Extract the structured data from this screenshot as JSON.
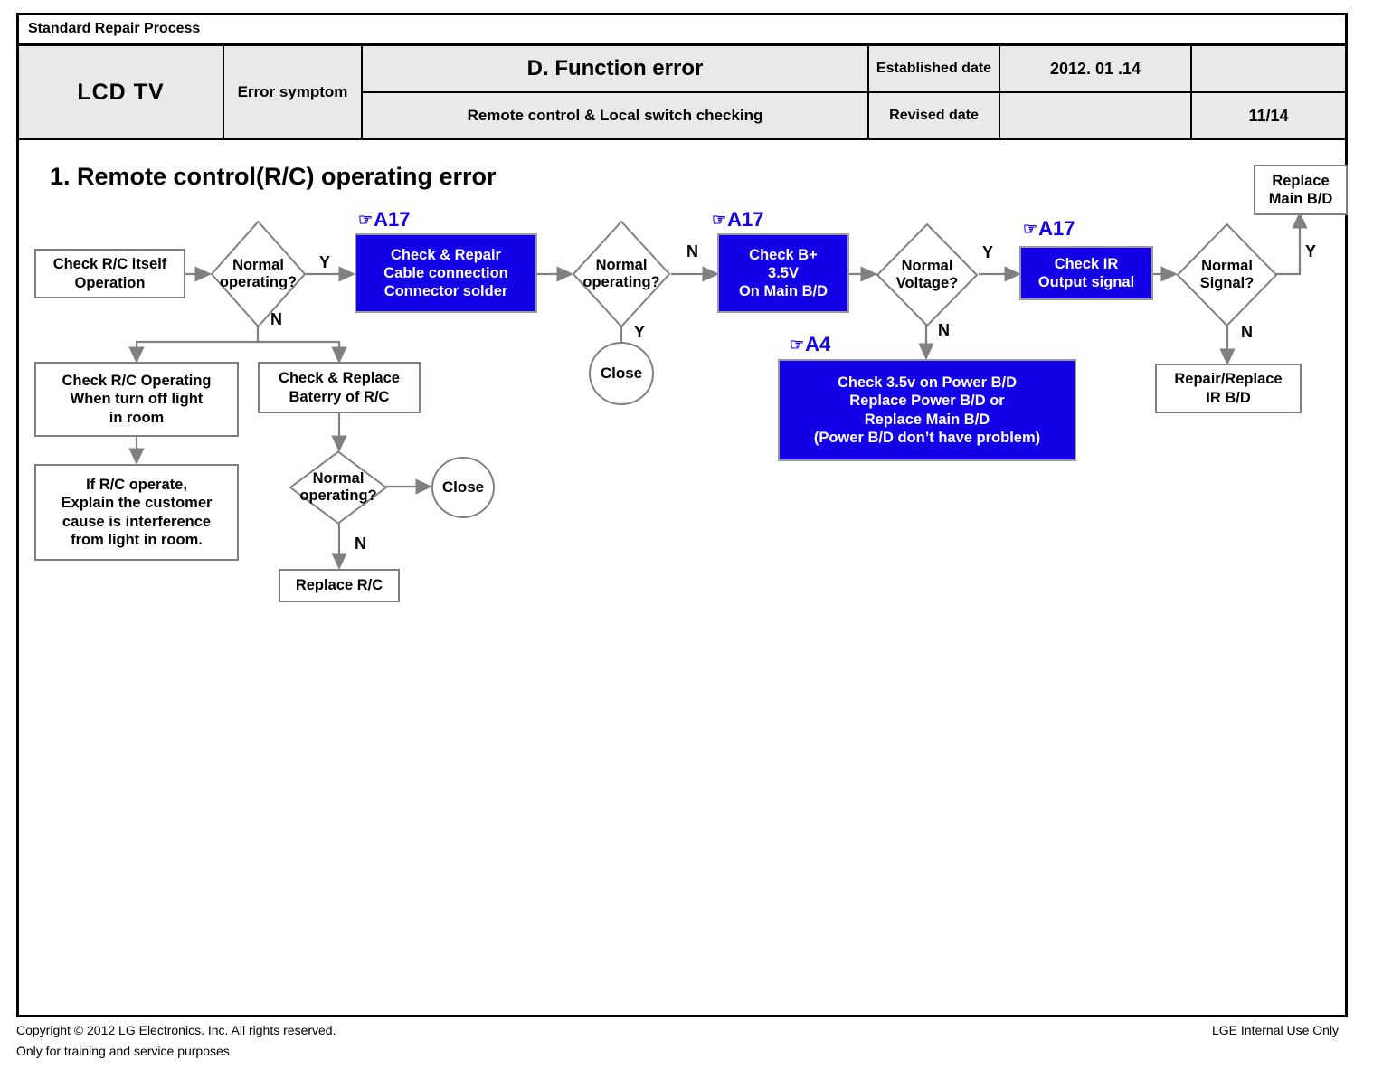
{
  "header": {
    "standard_title": "Standard Repair Process",
    "product": "LCD  TV",
    "error_symptom_label": "Error symptom",
    "function_error": "D. Function error",
    "subject": "Remote control & Local switch checking",
    "established_date_label": "Established date",
    "established_date_value": "2012. 01 .14",
    "revised_date_label": "Revised date",
    "revised_date_value": "",
    "blank_cell": "",
    "page_number": "11/14"
  },
  "section": {
    "title": "1. Remote control(R/C) operating error"
  },
  "flow": {
    "nodes": {
      "check_rc_itself": "Check R/C itself\nOperation",
      "d1": "Normal\noperating?",
      "check_repair_cable": "Check & Repair\nCable connection\nConnector solder",
      "d2": "Normal\noperating?",
      "close1": "Close",
      "check_b_plus": "Check B+\n3.5V\nOn Main B/D",
      "d3": "Normal\nVoltage?",
      "check_3_5v_power": "Check 3.5v on Power B/D\nReplace Power B/D or\nReplace Main B/D\n(Power B/D don’t have problem)",
      "check_ir": "Check IR\nOutput signal",
      "d4": "Normal\nSignal?",
      "replace_main_bd": "Replace\nMain B/D",
      "repair_replace_ir": "Repair/Replace\nIR B/D",
      "check_rc_operating_light": "Check R/C Operating\nWhen turn off light\nin room",
      "explain_customer": "If R/C operate,\nExplain the customer\ncause is interference\nfrom light in room.",
      "check_replace_battery": "Check & Replace\nBaterry of R/C",
      "d5": "Normal\noperating?",
      "close2": "Close",
      "replace_rc": "Replace R/C"
    },
    "tags": {
      "a17_1": "A17",
      "a17_2": "A17",
      "a17_3": "A17",
      "a4": "A4",
      "hand_glyph": "☞"
    },
    "edge_labels": {
      "d1_yes": "Y",
      "d1_no": "N",
      "d2_no": "N",
      "d2_yes": "Y",
      "d3_yes": "Y",
      "d3_no": "N",
      "d4_yes": "Y",
      "d4_no": "N",
      "d5_no": "N"
    }
  },
  "footer": {
    "copyright_line1": "Copyright © 2012 LG Electronics. Inc. All rights reserved.",
    "copyright_line2": "Only for training and service purposes",
    "internal_use": "LGE Internal Use Only"
  },
  "colors": {
    "blue_box": "#1400e6",
    "header_cell_bg": "#e9e9e9",
    "wire": "#808080"
  }
}
